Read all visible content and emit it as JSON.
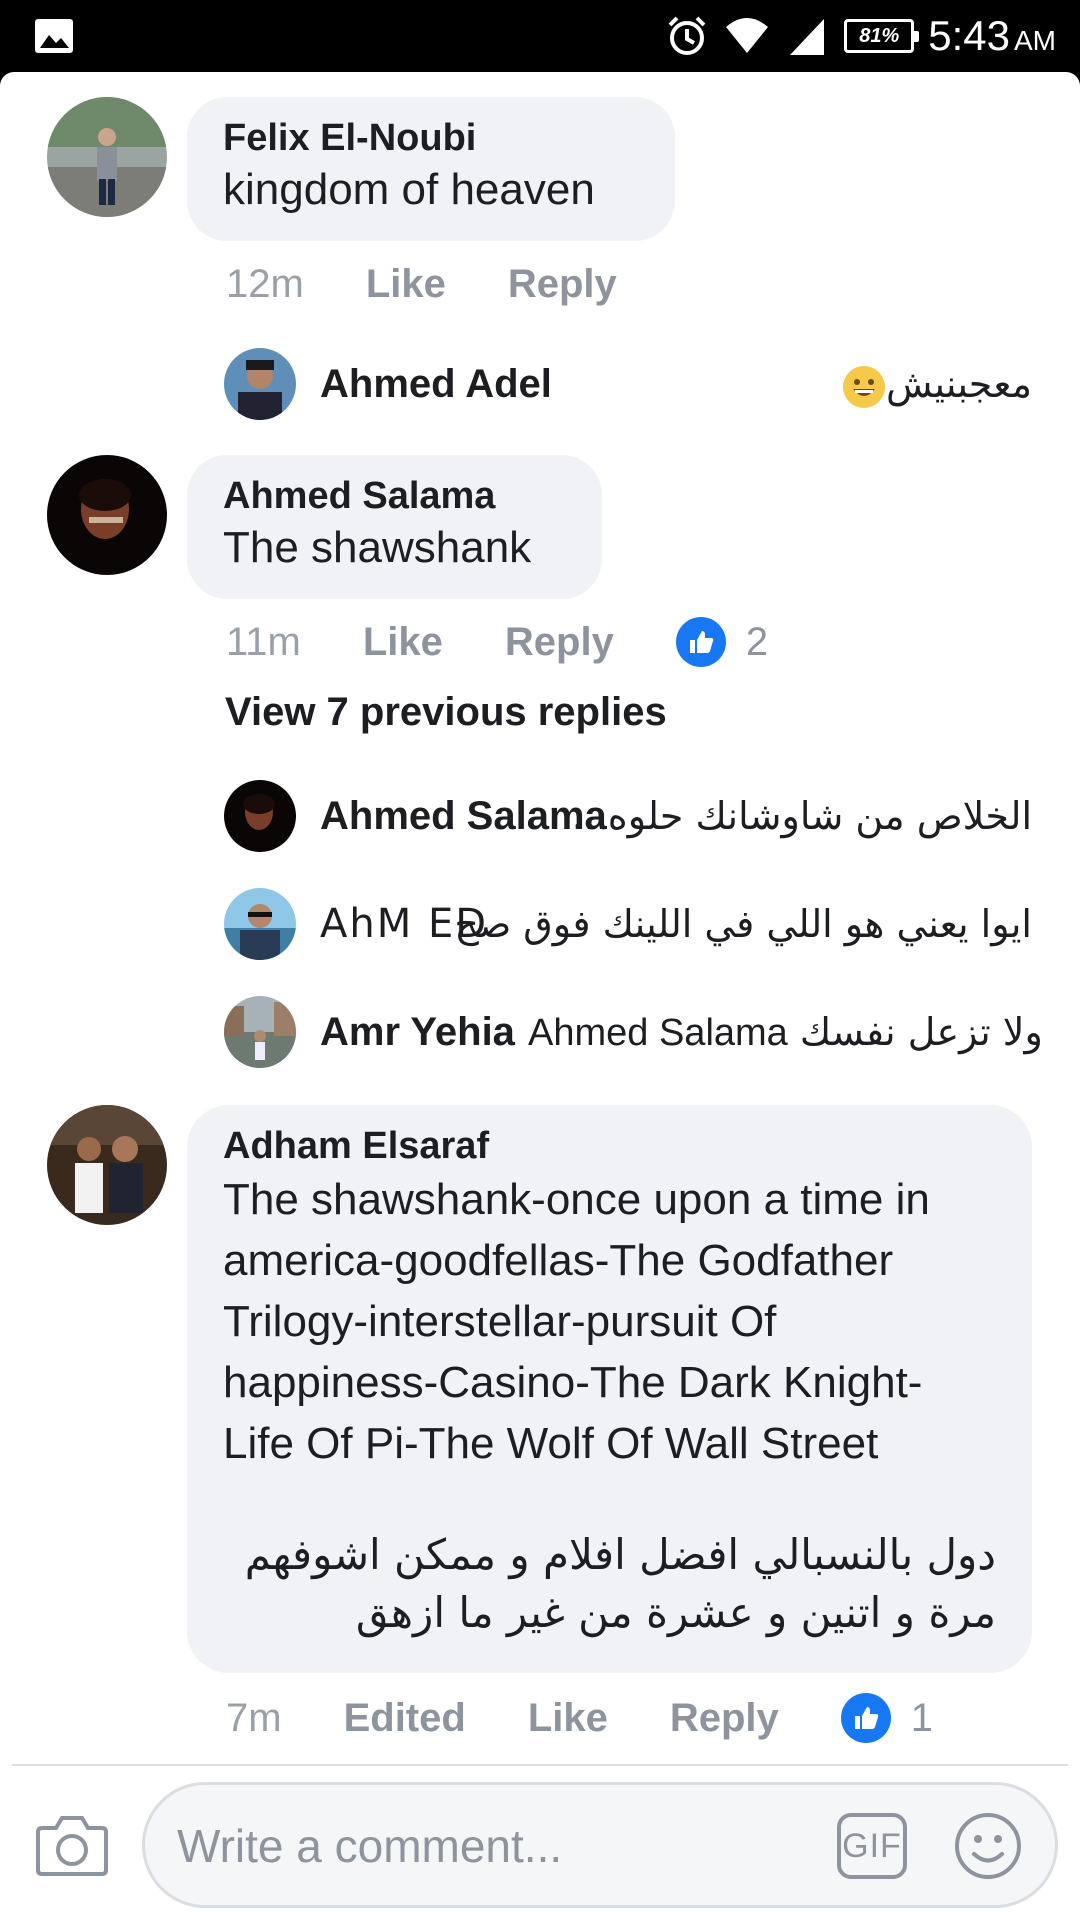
{
  "status_bar": {
    "battery": "81%",
    "time": "5:43",
    "ampm": "AM"
  },
  "comments": [
    {
      "author": "Felix El-Noubi",
      "text": "kingdom of heaven",
      "time": "12m",
      "like": "Like",
      "reply": "Reply"
    },
    {
      "author": "Ahmed Salama",
      "text": "The shawshank",
      "time": "11m",
      "like": "Like",
      "reply": "Reply",
      "reaction_count": "2"
    },
    {
      "author": "Adham Elsaraf",
      "text_lines": [
        "The shawshank-once upon a time in",
        "america-goodfellas-The Godfather",
        "Trilogy-interstellar-pursuit Of",
        "happiness-Casino-The Dark Knight-",
        "Life Of Pi-The Wolf Of Wall Street"
      ],
      "arabic_lines": [
        "دول بالنسبالي افضل افلام و ممكن اشوفهم",
        "مرة و اتنين و عشرة من غير ما ازهق"
      ],
      "time": "7m",
      "edited": "Edited",
      "like": "Like",
      "reply": "Reply",
      "reaction_count": "1"
    }
  ],
  "replies": [
    {
      "author": "Ahmed Adel",
      "text": "معجبنيش"
    },
    {
      "author": "Ahmed Salama",
      "text": "الخلاص من شاوشانك حلوه..."
    },
    {
      "author": "AhM ED",
      "text": "ايوا يعني هو اللي في اللينك فوق صح"
    },
    {
      "author": "Amr Yehia",
      "mention": "Ahmed Salama",
      "text": "ولا تزعل نفسك"
    }
  ],
  "view_previous": "View 7 previous replies",
  "composer": {
    "placeholder": "Write a comment...",
    "gif_label": "GIF"
  },
  "colors": {
    "like_blue": "#1877f2",
    "bubble_bg": "#f0f2f5",
    "meta_grey": "#8d949e"
  }
}
